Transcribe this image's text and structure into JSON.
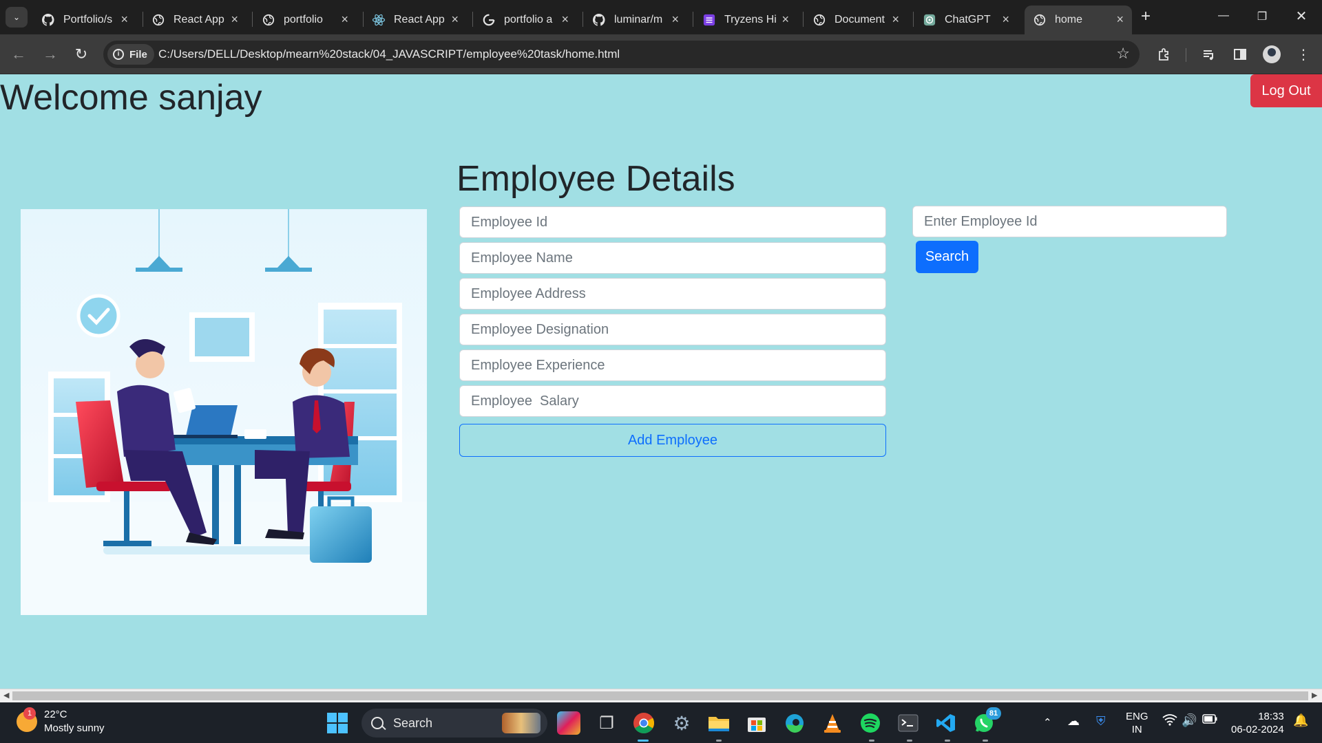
{
  "browser": {
    "tabs": [
      {
        "title": "Portfolio/s",
        "icon": "github-icon",
        "active": false
      },
      {
        "title": "React App",
        "icon": "globe-icon",
        "active": false
      },
      {
        "title": "portfolio",
        "icon": "globe-icon",
        "active": false
      },
      {
        "title": "React App",
        "icon": "react-icon",
        "active": false
      },
      {
        "title": "portfolio a",
        "icon": "google-icon",
        "active": false
      },
      {
        "title": "luminar/m",
        "icon": "github-icon",
        "active": false
      },
      {
        "title": "Tryzens Hi",
        "icon": "form-icon",
        "active": false
      },
      {
        "title": "Document",
        "icon": "globe-icon",
        "active": false
      },
      {
        "title": "ChatGPT",
        "icon": "chatgpt-icon",
        "active": false
      },
      {
        "title": "home",
        "icon": "globe-icon",
        "active": true
      }
    ],
    "address": {
      "chip_label": "File",
      "url": "C:/Users/DELL/Desktop/mearn%20stack/04_JAVASCRIPT/employee%20task/home.html"
    }
  },
  "page": {
    "welcome": "Welcome sanjay",
    "logout_label": "Log Out",
    "heading": "Employee Details",
    "form": {
      "placeholders": {
        "id": "Employee Id",
        "name": "Employee Name",
        "address": "Employee Address",
        "designation": "Employee Designation",
        "experience": "Employee Experience",
        "salary": "Employee  Salary"
      },
      "add_label": "Add Employee"
    },
    "search": {
      "placeholder": "Enter Employee Id",
      "button_label": "Search"
    },
    "colors": {
      "background": "#a1dfe4",
      "danger": "#dc3545",
      "primary": "#0d6efd"
    }
  },
  "taskbar": {
    "weather": {
      "temp": "22°C",
      "condition": "Mostly sunny",
      "badge": "1"
    },
    "search_label": "Search",
    "whatsapp_badge": "81",
    "language": {
      "line1": "ENG",
      "line2": "IN"
    },
    "clock": {
      "time": "18:33",
      "date": "06-02-2024"
    }
  }
}
